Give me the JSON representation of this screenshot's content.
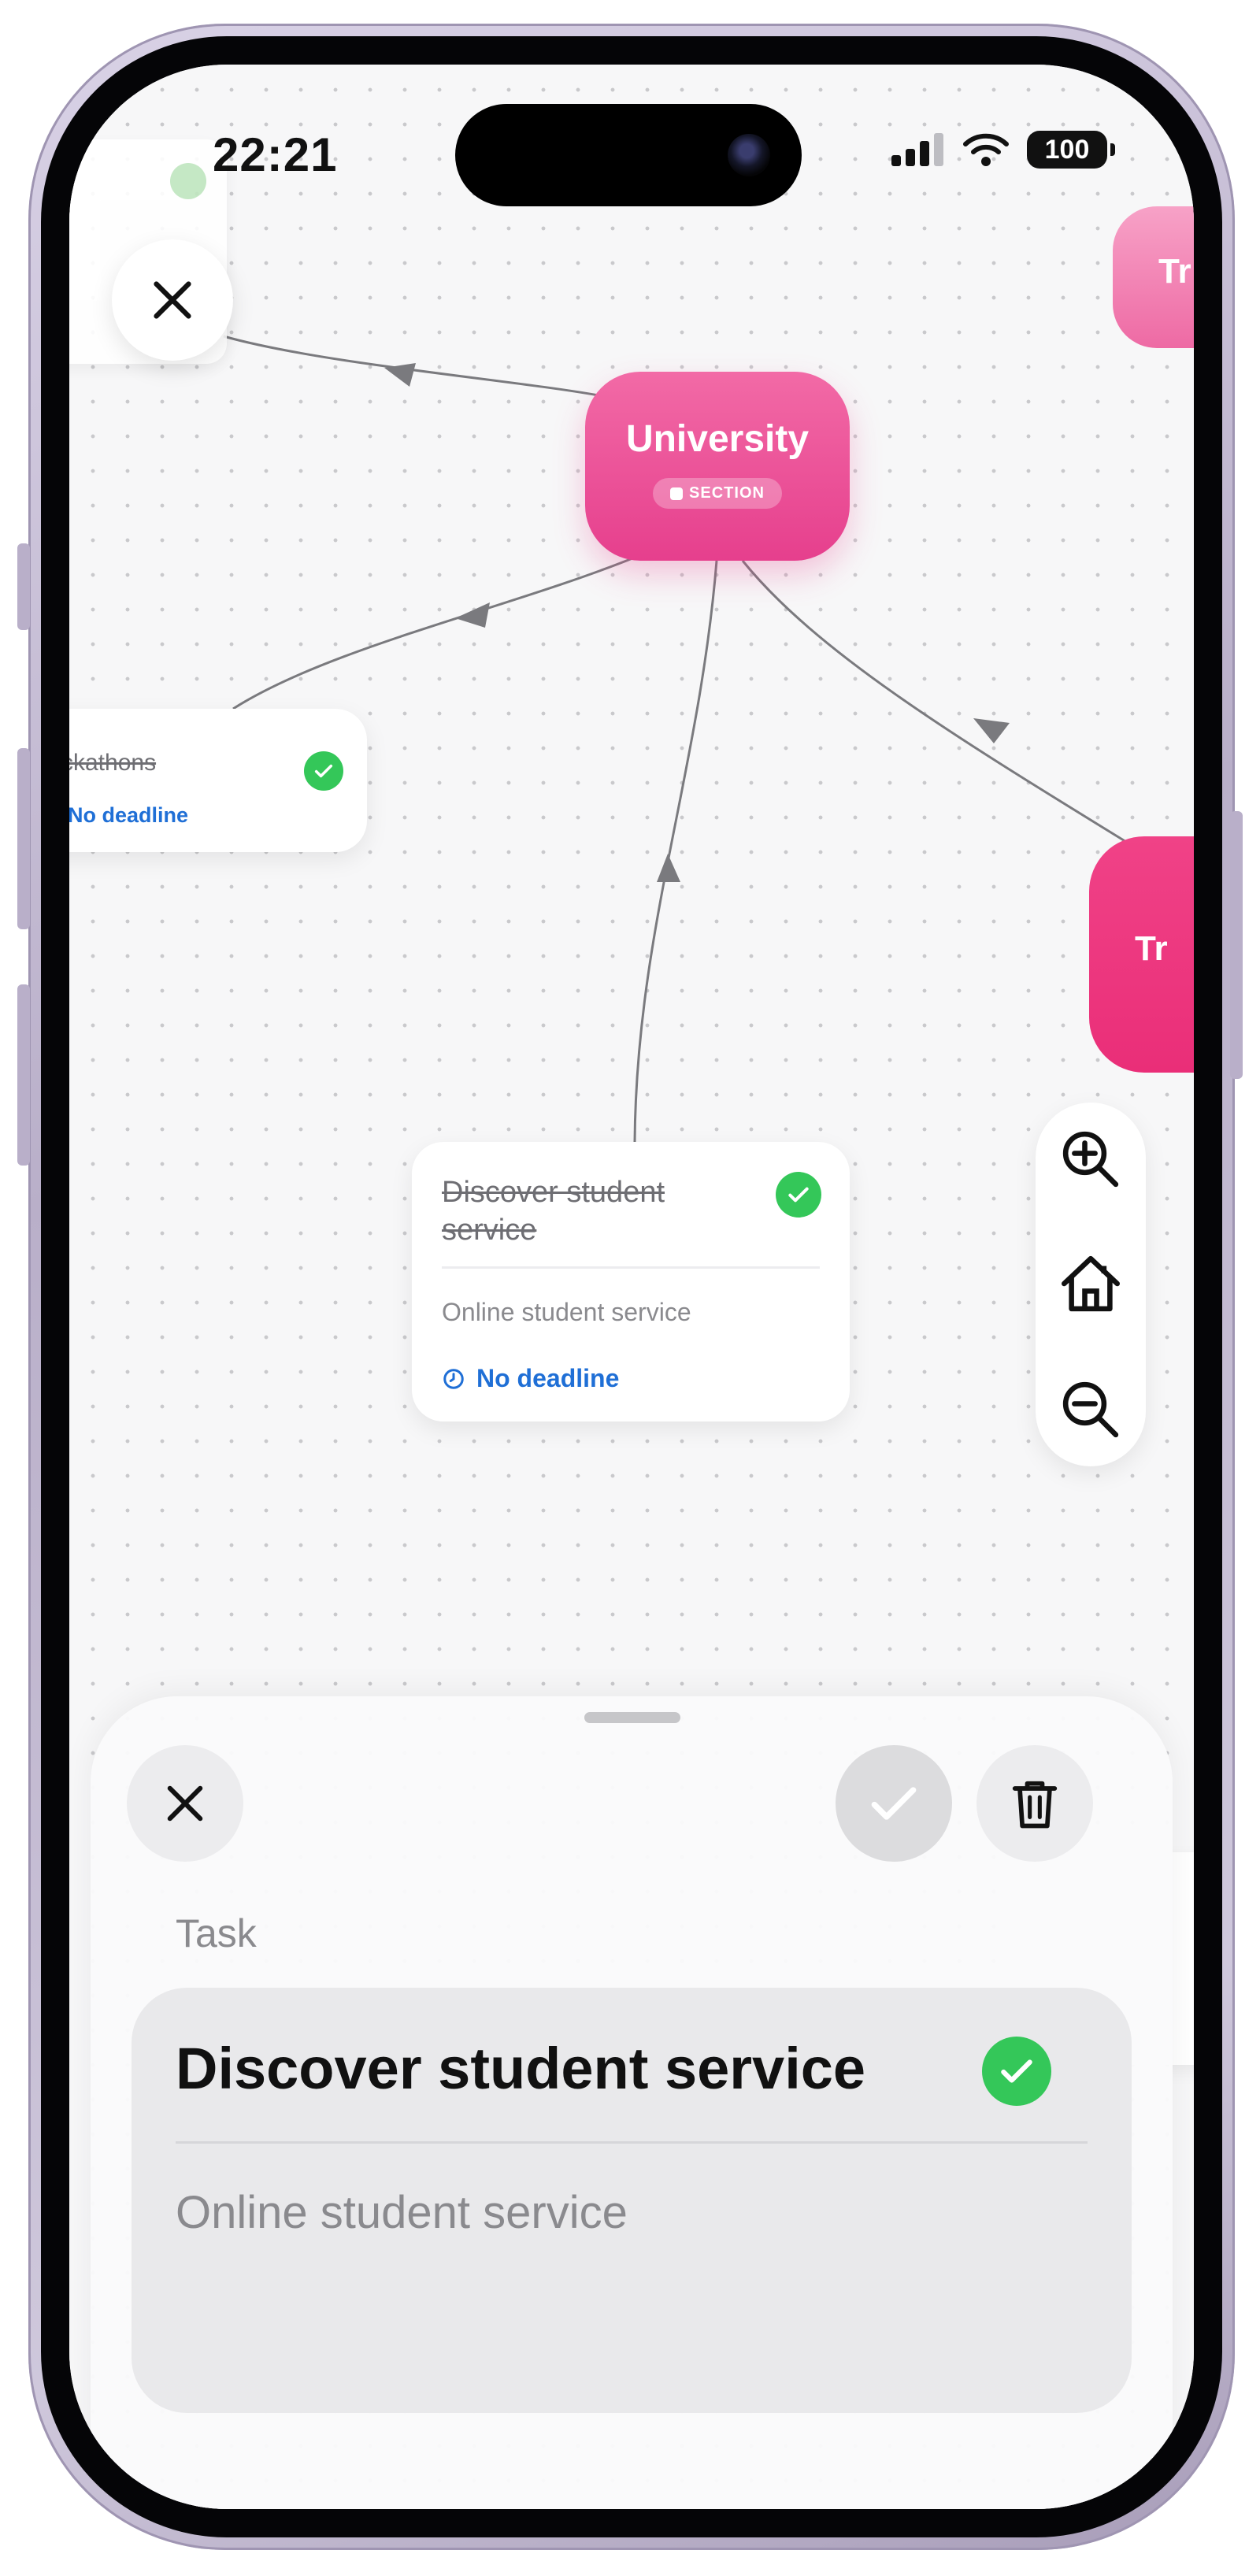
{
  "status_bar": {
    "time": "22:21",
    "battery": "100"
  },
  "canvas": {
    "section_node": {
      "title": "University",
      "badge": "SECTION"
    },
    "right_nodes": [
      "Tr",
      "Tr"
    ],
    "task_cards": [
      {
        "title": "ckathons",
        "completed": true,
        "deadline": "No deadline"
      },
      {
        "title": "Discover student service",
        "completed": true,
        "description": "Online student service",
        "deadline": "No deadline"
      }
    ],
    "zoom_controls": [
      "zoom-in-icon",
      "home-icon",
      "zoom-out-icon"
    ]
  },
  "sheet": {
    "kind_label": "Task",
    "title": "Discover student service",
    "description": "Online student service",
    "completed": true
  },
  "colors": {
    "accent_pink": "#e63f8d",
    "check_green": "#34c759",
    "link_blue": "#1f6fd6"
  }
}
